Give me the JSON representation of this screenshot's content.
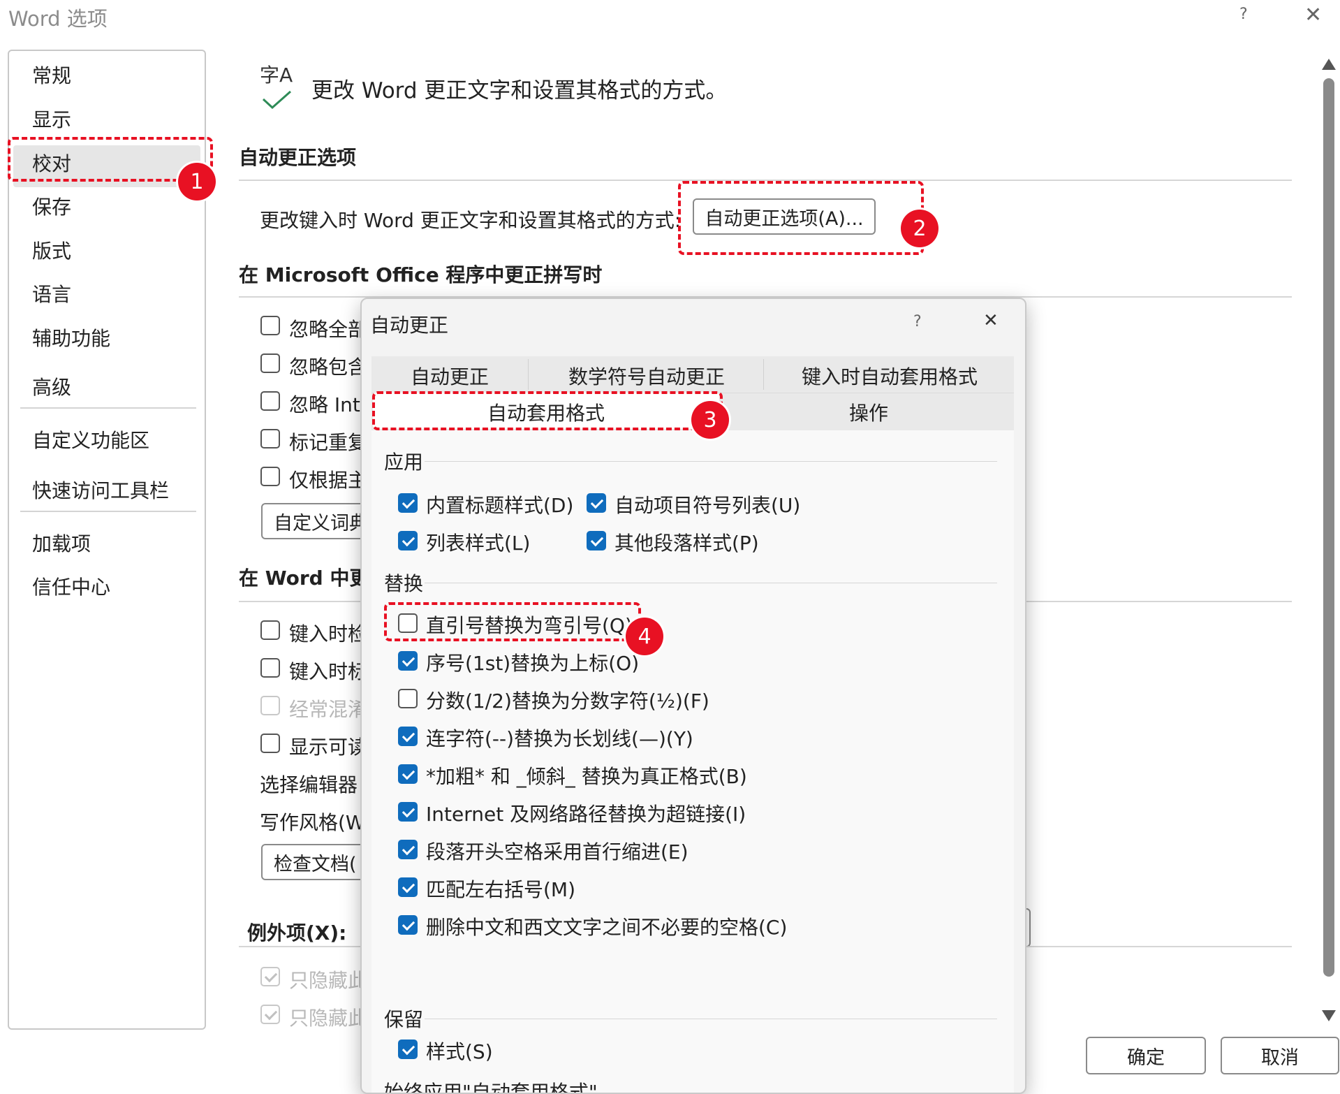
{
  "window": {
    "title": "Word 选项",
    "help_label": "?",
    "close_label": "✕"
  },
  "nav": {
    "items": [
      {
        "label": "常规"
      },
      {
        "label": "显示"
      },
      {
        "label": "校对"
      },
      {
        "label": "保存"
      },
      {
        "label": "版式"
      },
      {
        "label": "语言"
      },
      {
        "label": "辅助功能"
      },
      {
        "label": "高级"
      },
      {
        "label": "自定义功能区"
      },
      {
        "label": "快速访问工具栏"
      },
      {
        "label": "加载项"
      },
      {
        "label": "信任中心"
      }
    ],
    "selected": "校对"
  },
  "main": {
    "header_icon_text": "字A",
    "header": "更改 Word 更正文字和设置其格式的方式。",
    "autocorrect_section": {
      "title": "自动更正选项",
      "description": "更改键入时 Word 更正文字和设置其格式的方式:",
      "button": "自动更正选项(A)..."
    },
    "office_section": {
      "title": "在 Microsoft Office 程序中更正拼写时",
      "options": [
        {
          "label": "忽略全部",
          "checked": false
        },
        {
          "label": "忽略包含",
          "checked": false
        },
        {
          "label": "忽略 Int",
          "checked": false
        },
        {
          "label": "标记重复",
          "checked": false
        },
        {
          "label": "仅根据主",
          "checked": false
        }
      ],
      "custom_dict_button": "自定义词典"
    },
    "word_section": {
      "title": "在 Word 中更",
      "options": [
        {
          "label": "键入时检",
          "checked": false,
          "disabled": false
        },
        {
          "label": "键入时标",
          "checked": false,
          "disabled": false
        },
        {
          "label": "经常混淆",
          "checked": false,
          "disabled": true
        },
        {
          "label": "显示可读",
          "checked": false,
          "disabled": false
        }
      ],
      "editor_label": "选择编辑器",
      "writing_style_label": "写作风格(W",
      "check_doc_button": "检查文档("
    },
    "exceptions": {
      "title": "例外项(X):",
      "options": [
        {
          "label": "只隐藏此",
          "checked": true,
          "disabled": true
        },
        {
          "label": "只隐藏此",
          "checked": true,
          "disabled": true
        }
      ]
    },
    "ok_button": "确定",
    "cancel_button": "取消"
  },
  "modal": {
    "title": "自动更正",
    "help_label": "?",
    "close_label": "✕",
    "tabs_row1": [
      "自动更正",
      "数学符号自动更正",
      "键入时自动套用格式"
    ],
    "tabs_row2": [
      "自动套用格式",
      "操作"
    ],
    "active_tab": "自动套用格式",
    "apply_group": {
      "title": "应用",
      "options": [
        {
          "label": "内置标题样式(D)",
          "checked": true
        },
        {
          "label": "自动项目符号列表(U)",
          "checked": true
        },
        {
          "label": "列表样式(L)",
          "checked": true
        },
        {
          "label": "其他段落样式(P)",
          "checked": true
        }
      ]
    },
    "replace_group": {
      "title": "替换",
      "options": [
        {
          "label": "直引号替换为弯引号(Q)",
          "checked": false
        },
        {
          "label": "序号(1st)替换为上标(O)",
          "checked": true
        },
        {
          "label": "分数(1/2)替换为分数字符(½)(F)",
          "checked": false
        },
        {
          "label": "连字符(--)替换为长划线(—)(Y)",
          "checked": true
        },
        {
          "label": "*加粗* 和 _倾斜_ 替换为真正格式(B)",
          "checked": true
        },
        {
          "label": "Internet 及网络路径替换为超链接(I)",
          "checked": true
        },
        {
          "label": "段落开头空格采用首行缩进(E)",
          "checked": true
        },
        {
          "label": "匹配左右括号(M)",
          "checked": true
        },
        {
          "label": "删除中文和西文文字之间不必要的空格(C)",
          "checked": true
        }
      ]
    },
    "keep_group": {
      "title": "保留",
      "options": [
        {
          "label": "样式(S)",
          "checked": true
        }
      ]
    },
    "bottom_partial_text": "始终应用\"自动套用格式\""
  },
  "annotations": [
    "1",
    "2",
    "3",
    "4"
  ],
  "colors": {
    "accent": "#0f6cbd",
    "annotation_red": "#e81123",
    "selected_bg": "#e6e6e6"
  }
}
